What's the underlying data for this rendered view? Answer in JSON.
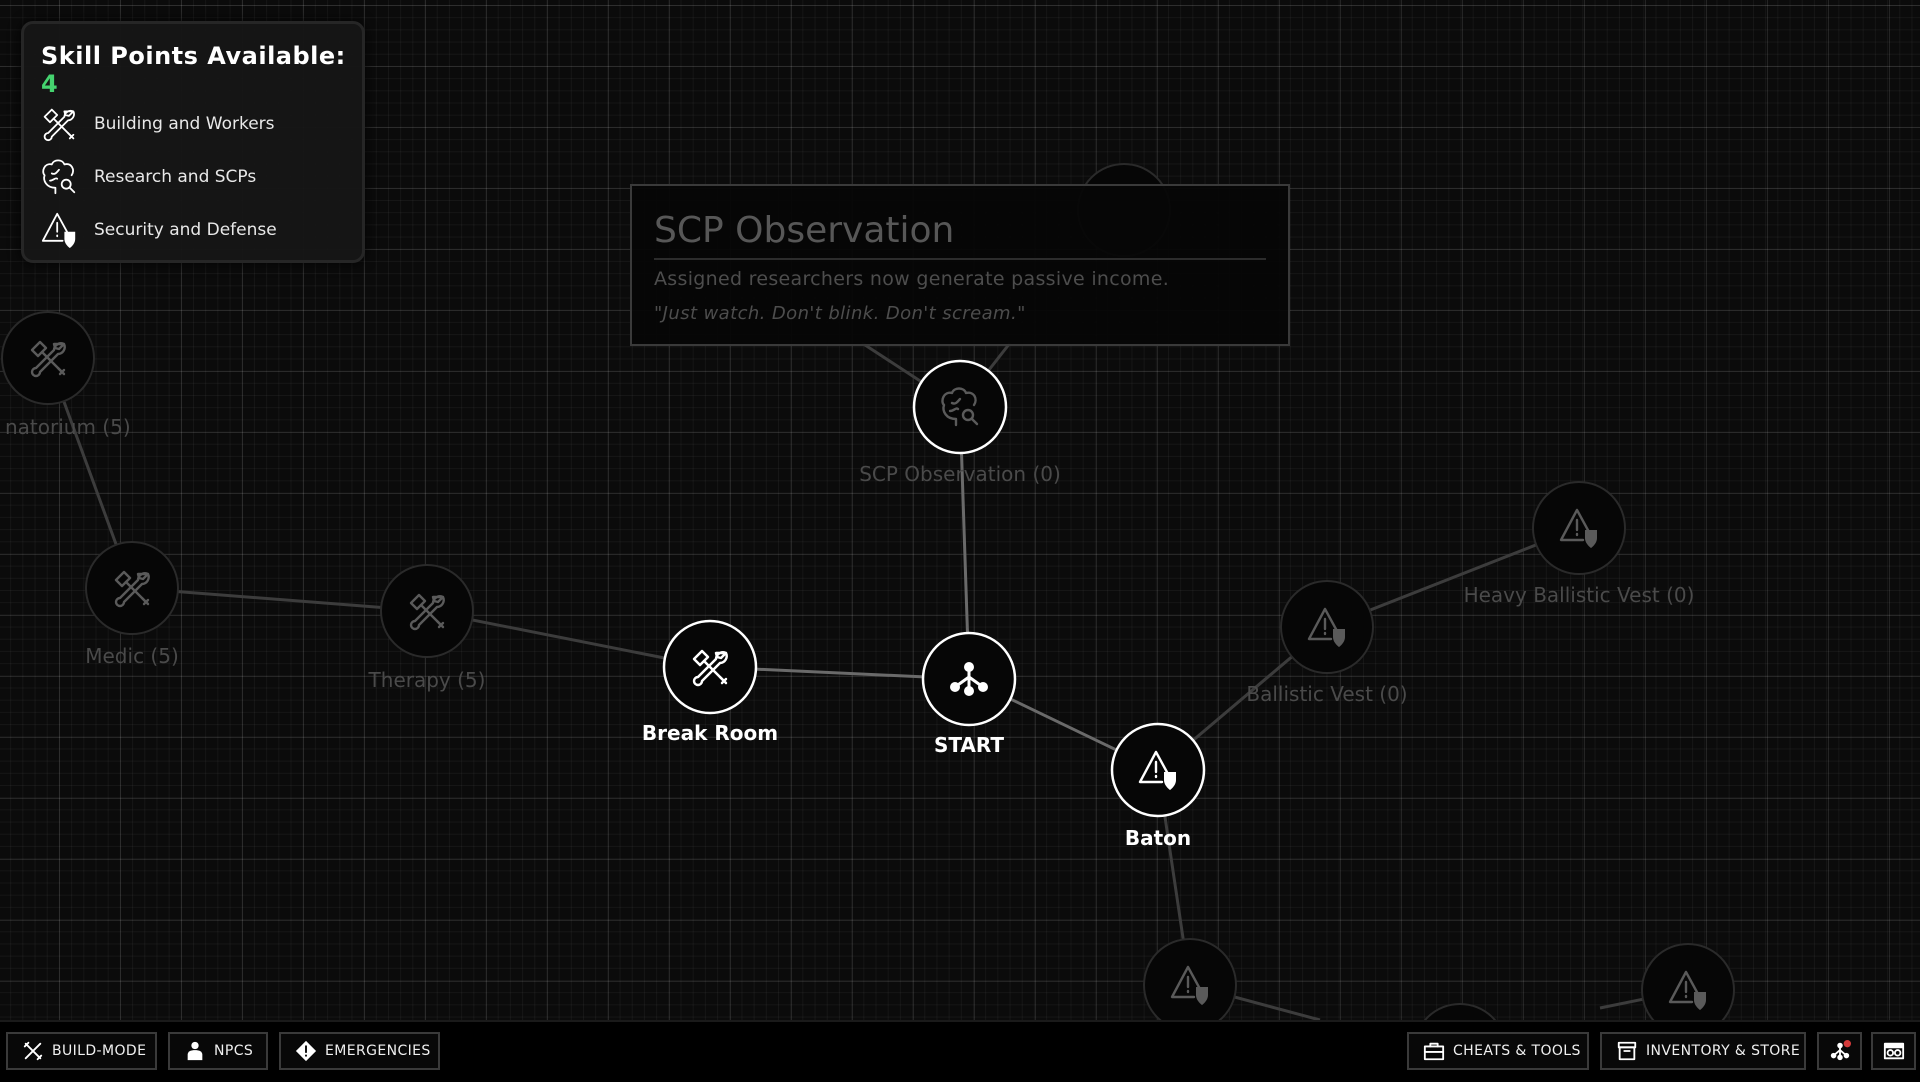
{
  "skill_panel": {
    "title": "Skill Points Available:",
    "points": "4",
    "legend": [
      {
        "icon": "wrench-screwdriver-icon",
        "label": "Building and Workers"
      },
      {
        "icon": "brain-search-icon",
        "label": "Research and SCPs"
      },
      {
        "icon": "warning-shield-icon",
        "label": "Security and Defense"
      }
    ]
  },
  "tooltip": {
    "title": "SCP Observation",
    "description": "Assigned researchers now generate passive income.",
    "quote": "\"Just watch. Don't blink. Don't scream.\""
  },
  "nodes": {
    "sanatorium": "natorium (5)",
    "medic": "Medic (5)",
    "therapy": "Therapy (5)",
    "break_room": "Break Room",
    "start": "START",
    "scp_observation": "SCP Observation (0)",
    "baton": "Baton",
    "ballistic_vest": "Ballistic Vest (0)",
    "heavy_ballistic_vest": "Heavy Ballistic Vest (0)"
  },
  "bottom_bar": {
    "build_mode": "BUILD-MODE",
    "npcs": "NPCS",
    "emergencies": "EMERGENCIES",
    "cheats_tools": "CHEATS & TOOLS",
    "inventory_store": "INVENTORY & STORE"
  },
  "colors": {
    "background": "#0b0b0b",
    "skill_points": "#45d36f",
    "notification": "#d33a3a"
  }
}
